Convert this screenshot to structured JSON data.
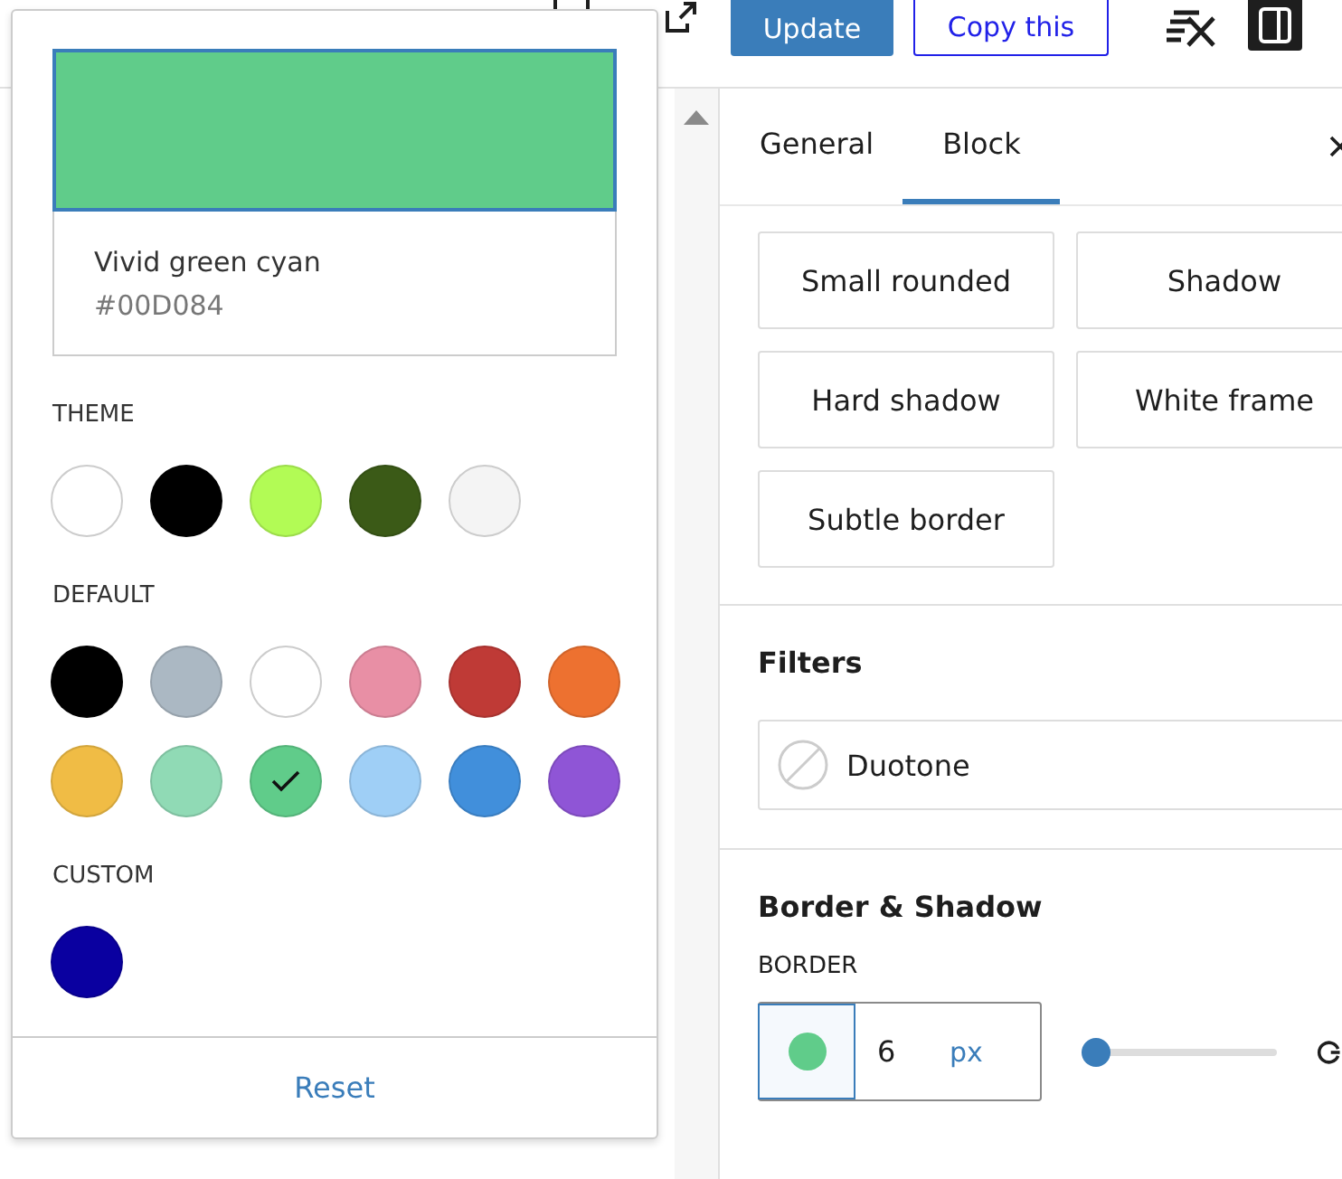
{
  "toolbar": {
    "buttons": [
      {
        "label": "Update",
        "kind": "primary"
      },
      {
        "label": "Copy this",
        "kind": "outline"
      }
    ]
  },
  "color_popover": {
    "preview": {
      "name": "Vivid green cyan",
      "value": "#00D084",
      "color": "#60cc8a"
    },
    "palettes": [
      {
        "label": "THEME",
        "swatches": [
          {
            "color": "#ffffff",
            "selected": false
          },
          {
            "color": "#000000",
            "selected": false
          },
          {
            "color": "#b2fb55",
            "selected": false
          },
          {
            "color": "#3b5a17",
            "selected": false
          },
          {
            "color": "#f4f4f4",
            "selected": false
          }
        ]
      },
      {
        "label": "DEFAULT",
        "swatches": [
          {
            "color": "#000000",
            "selected": false
          },
          {
            "color": "#abb8c3",
            "selected": false
          },
          {
            "color": "#ffffff",
            "selected": false
          },
          {
            "color": "#e88fa5",
            "selected": false
          },
          {
            "color": "#bf3a36",
            "selected": false
          },
          {
            "color": "#ed7130",
            "selected": false
          },
          {
            "color": "#f0bc45",
            "selected": false
          },
          {
            "color": "#90dab5",
            "selected": false
          },
          {
            "color": "#60cc8a",
            "selected": true
          },
          {
            "color": "#9fcff6",
            "selected": false
          },
          {
            "color": "#418fdb",
            "selected": false
          },
          {
            "color": "#8f55d6",
            "selected": false
          }
        ]
      },
      {
        "label": "CUSTOM",
        "swatches": [
          {
            "color": "#0a00a0",
            "selected": false
          }
        ]
      }
    ],
    "reset": "Reset"
  },
  "sidebar": {
    "tabs": [
      {
        "label": "General",
        "selected": false
      },
      {
        "label": "Block",
        "selected": true
      }
    ],
    "styles": [
      "Small rounded",
      "Shadow",
      "Hard shadow",
      "White frame",
      "Subtle border"
    ],
    "filters": {
      "title": "Filters",
      "duotone": "Duotone"
    },
    "border_shadow": {
      "title": "Border & Shadow",
      "border_label": "BORDER",
      "color": "#60cc8a",
      "value": "6",
      "unit": "px",
      "level": 0
    }
  }
}
